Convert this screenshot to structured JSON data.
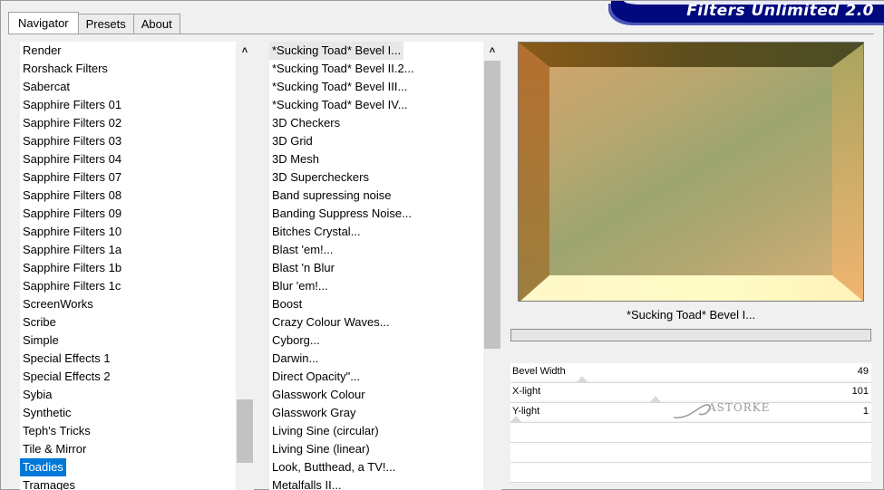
{
  "tabs": [
    {
      "label": "Navigator",
      "active": true
    },
    {
      "label": "Presets",
      "active": false
    },
    {
      "label": "About",
      "active": false
    }
  ],
  "brand": {
    "title": "Filters Unlimited 2.0",
    "color": "#00097e"
  },
  "categories": {
    "items": [
      "Render",
      "Rorshack Filters",
      "Sabercat",
      "Sapphire Filters 01",
      "Sapphire Filters 02",
      "Sapphire Filters 03",
      "Sapphire Filters 04",
      "Sapphire Filters 07",
      "Sapphire Filters 08",
      "Sapphire Filters 09",
      "Sapphire Filters 10",
      "Sapphire Filters 1a",
      "Sapphire Filters 1b",
      "Sapphire Filters 1c",
      "ScreenWorks",
      "Scribe",
      "Simple",
      "Special Effects 1",
      "Special Effects 2",
      "Sybia",
      "Synthetic",
      "Teph's Tricks",
      "Tile & Mirror",
      "Toadies",
      "Tramages"
    ],
    "selected_index": 23,
    "scroll_position": 0.92
  },
  "filters": {
    "items": [
      "*Sucking Toad*  Bevel I...",
      "*Sucking Toad*  Bevel II.2...",
      "*Sucking Toad*  Bevel III...",
      "*Sucking Toad*  Bevel IV...",
      "3D Checkers",
      "3D Grid",
      "3D Mesh",
      "3D Supercheckers",
      "Band supressing noise",
      "Banding Suppress Noise...",
      "Bitches Crystal...",
      "Blast 'em!...",
      "Blast 'n Blur",
      "Blur 'em!...",
      "Boost",
      "Crazy Colour Waves...",
      "Cyborg...",
      "Darwin...",
      "Direct Opacity\"...",
      "Glasswork Colour",
      "Glasswork Gray",
      "Living Sine (circular)",
      "Living Sine (linear)",
      "Look, Butthead, a TV!...",
      "Metalfalls II..."
    ],
    "selected_index": 0,
    "scroll_position": 0.0
  },
  "preview": {
    "filter_name": "*Sucking Toad*  Bevel I..."
  },
  "params": [
    {
      "label": "Bevel Width",
      "value": "49",
      "level": 0.19
    },
    {
      "label": "X-light",
      "value": "101",
      "level": 0.4
    },
    {
      "label": "Y-light",
      "value": "1",
      "level": 0.0
    }
  ],
  "watermark": {
    "text": "ASTORKE"
  }
}
